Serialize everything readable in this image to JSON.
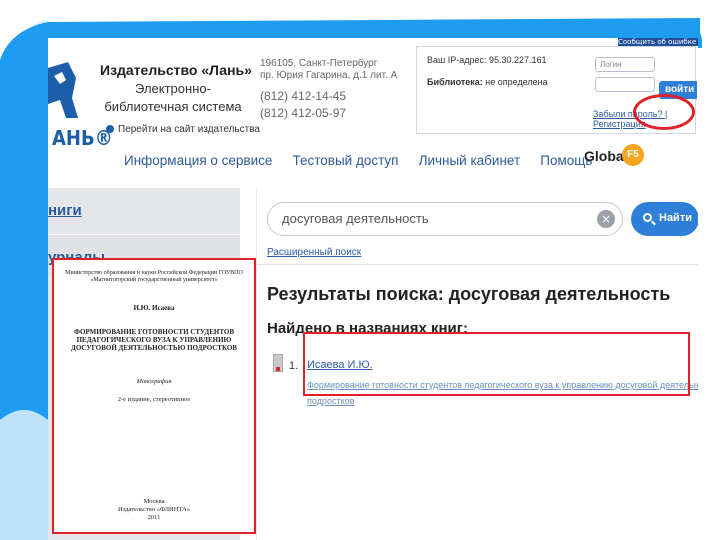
{
  "header": {
    "publisher_title": "Издательство «Лань»",
    "publisher_subtitle": "Электронно-библиотечная система",
    "publisher_link": "Перейти на сайт издательства",
    "logo_text": "АНЬ®",
    "address_line1": "196105, Санкт-Петербург",
    "address_line2": "пр. Юрия Гагарина, д.1 лит. А",
    "phone1": "(812) 412-14-45",
    "phone2": "(812) 412-05-97",
    "report_button": "Сообщить об ошибке"
  },
  "login": {
    "ip_text": "Ваш IP-адрес: 95.30.227.161",
    "library_label": "Библиотека:",
    "library_value": "не определена",
    "login_placeholder": "Логин",
    "enter_label": "войти",
    "forgot_text": "Забыли пароль?",
    "register_text": "| Регистрация"
  },
  "nav": {
    "items": [
      "Информация о сервисе",
      "Тестовый доступ",
      "Личный кабинет",
      "Помощь"
    ],
    "global_label": "Global",
    "f5_label": "F5"
  },
  "sidebar": {
    "items": [
      {
        "label": "ниги"
      },
      {
        "label": "урналы"
      }
    ]
  },
  "search": {
    "query": "досуговая деятельность",
    "button_label": "Найти",
    "advanced_link": "Расширенный поиск"
  },
  "results": {
    "title": "Результаты поиска: досуговая деятельность",
    "found_heading": "Найдено в названиях книг:",
    "items": [
      {
        "number": "1.",
        "author": "Исаева И.Ю.",
        "title_line1": "Формирование готовности студентов педагогического вуза к управлению досуговой деятельностью",
        "title_line2": "подростков"
      }
    ]
  },
  "cover": {
    "ministry": "Министерство образования и науки Российской Федерации ГОУВПО «Магнитогорский государственный университет»",
    "author": "И.Ю. Исаева",
    "title": "ФОРМИРОВАНИЕ ГОТОВНОСТИ СТУДЕНТОВ ПЕДАГОГИЧЕСКОГО ВУЗА К УПРАВЛЕНИЮ ДОСУГОВОЙ ДЕЯТЕЛЬНОСТЬЮ ПОДРОСТКОВ",
    "type": "Монография",
    "edition": "2-е издание, стереотипное",
    "city": "Москва",
    "publisher": "Издательство «ФЛИНТА»",
    "year": "2011"
  },
  "colors": {
    "accent": "#2f7fd8",
    "link": "#2d5a98",
    "highlight": "#e0212c",
    "decor": "#1e9cf0"
  }
}
